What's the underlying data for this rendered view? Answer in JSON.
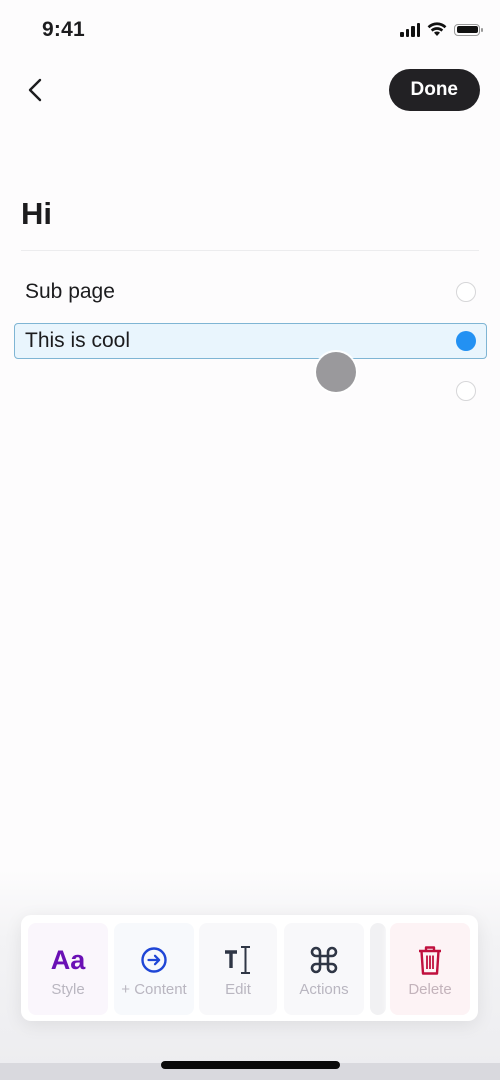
{
  "status_bar": {
    "time": "9:41",
    "icons": [
      "cellular-signal-icon",
      "wifi-icon",
      "battery-icon"
    ]
  },
  "nav": {
    "back_icon": "chevron-left-icon",
    "done_label": "Done"
  },
  "page": {
    "title": "Hi",
    "items": [
      {
        "label": "Sub page",
        "selected": false
      },
      {
        "label": "This is cool",
        "selected": true
      },
      {
        "label": "",
        "selected": false
      }
    ]
  },
  "toolbar": {
    "items": [
      {
        "label": "Style",
        "icon": "text-style-icon",
        "glyph": "Aa",
        "color": "#6a10b5"
      },
      {
        "label": "+ Content",
        "icon": "arrow-circle-right-icon",
        "color": "#1f46d6"
      },
      {
        "label": "Edit",
        "icon": "text-cursor-icon",
        "color": "#2f3645"
      },
      {
        "label": "Actions",
        "icon": "command-icon",
        "color": "#2f3645"
      },
      {
        "label": "Delete",
        "icon": "trash-icon",
        "color": "#c0103e"
      }
    ]
  },
  "colors": {
    "selection_bg": "#e9f5fd",
    "selection_border": "#7fb5d4",
    "radio_selected": "#2391f3",
    "done_button_bg": "#222124"
  }
}
